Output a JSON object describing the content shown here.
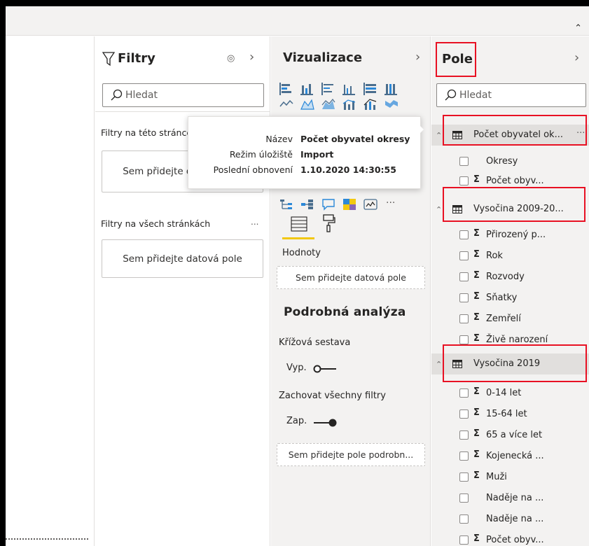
{
  "filters": {
    "title": "Filtry",
    "search_placeholder": "Hledat",
    "section_page": "Filtry na této stránce",
    "page_drop_label": "Sem přidejte datová pole",
    "section_all": "Filtry na všech stránkách",
    "all_drop_label": "Sem přidejte datová pole",
    "more_label": "..."
  },
  "viz": {
    "title": "Vizualizace",
    "values_label": "Hodnoty",
    "values_drop": "Sem přidejte datová pole",
    "drill_title": "Podrobná analýza",
    "cross_report_label": "Křížová sestava",
    "cross_report_state": "Vyp.",
    "keep_filters_label": "Zachovat všechny filtry",
    "keep_filters_state": "Zap.",
    "drill_drop": "Sem přidejte pole podrobn...",
    "more_visuals": "···"
  },
  "fields": {
    "title": "Pole",
    "search_placeholder": "Hledat",
    "tables": [
      {
        "name": "Počet obyvatel ok...",
        "fields": [
          {
            "name": "Okresy",
            "sigma": false
          },
          {
            "name": "Počet obyv...",
            "sigma": true
          }
        ]
      },
      {
        "name": "Vysočina 2009-20...",
        "fields": [
          {
            "name": "Přirozený p...",
            "sigma": true
          },
          {
            "name": "Rok",
            "sigma": true
          },
          {
            "name": "Rozvody",
            "sigma": true
          },
          {
            "name": "Sňatky",
            "sigma": true
          },
          {
            "name": "Zemřelí",
            "sigma": true
          },
          {
            "name": "Živě narození",
            "sigma": true
          }
        ]
      },
      {
        "name": "Vysočina 2019",
        "fields": [
          {
            "name": "0-14 let",
            "sigma": true
          },
          {
            "name": "15-64 let",
            "sigma": true
          },
          {
            "name": "65 a více let",
            "sigma": true
          },
          {
            "name": "Kojenecká ...",
            "sigma": true
          },
          {
            "name": "Muži",
            "sigma": true
          },
          {
            "name": "Naděje na ...",
            "sigma": false
          },
          {
            "name": "Naděje na ...",
            "sigma": false
          },
          {
            "name": "Počet obyv...",
            "sigma": true
          }
        ]
      }
    ],
    "sigma_symbol": "Σ",
    "more_label": "···"
  },
  "tooltip": {
    "rows": [
      {
        "key": "Název",
        "value": "Počet obyvatel okresy"
      },
      {
        "key": "Režim úložiště",
        "value": "Import"
      },
      {
        "key": "Poslední obnovení",
        "value": "1.10.2020 14:30:55"
      }
    ]
  },
  "colors": {
    "highlight_box": "#e81123",
    "accent_underline": "#f2c811",
    "pane_bg": "#f3f2f1"
  }
}
